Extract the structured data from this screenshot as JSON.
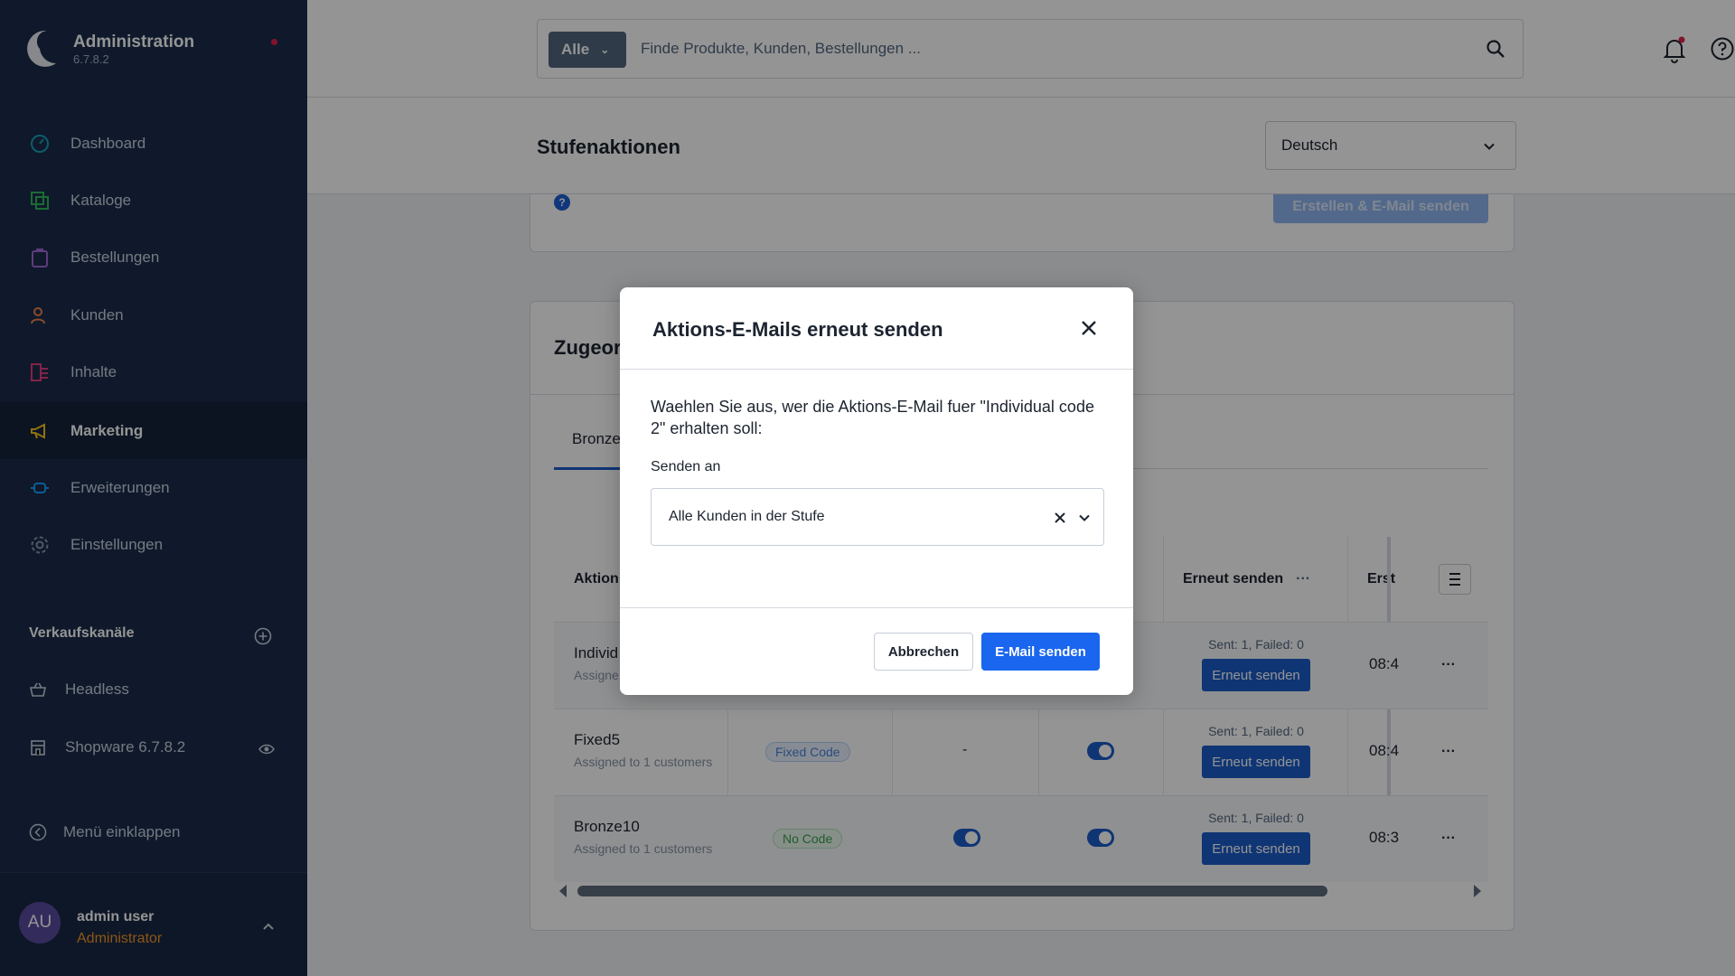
{
  "brand": {
    "title": "Administration",
    "version": "6.7.8.2"
  },
  "nav": [
    {
      "label": "Dashboard",
      "icon": "dashboard-icon"
    },
    {
      "label": "Kataloge",
      "icon": "catalog-icon"
    },
    {
      "label": "Bestellungen",
      "icon": "orders-icon"
    },
    {
      "label": "Kunden",
      "icon": "customers-icon"
    },
    {
      "label": "Inhalte",
      "icon": "content-icon"
    },
    {
      "label": "Marketing",
      "icon": "megaphone-icon",
      "active": true
    },
    {
      "label": "Erweiterungen",
      "icon": "plug-icon"
    },
    {
      "label": "Einstellungen",
      "icon": "gear-icon"
    }
  ],
  "sales_channels": {
    "heading": "Verkaufskanäle",
    "items": [
      {
        "label": "Headless",
        "icon": "basket-icon"
      },
      {
        "label": "Shopware 6.7.8.2",
        "icon": "storefront-icon"
      }
    ]
  },
  "collapse_label": "Menü einklappen",
  "user": {
    "initials": "AU",
    "name": "admin user",
    "role": "Administrator"
  },
  "search": {
    "type_label": "Alle",
    "placeholder": "Finde Produkte, Kunden, Bestellungen ..."
  },
  "page": {
    "title": "Stufenaktionen",
    "language": "Deutsch"
  },
  "card1": {
    "info": "?",
    "button": "Erstellen & E-Mail senden"
  },
  "card2": {
    "title": "Zugeordnete Aktionen",
    "tab": "Bronze",
    "columns": {
      "aktion": "Aktion",
      "erneut": "Erneut senden",
      "erstellt": "Erst",
      "more": "···"
    },
    "rows": [
      {
        "name": "Individ",
        "sub": "Assigne",
        "sent": "Sent: 1, Failed: 0",
        "resend": "Erneut senden",
        "time": "08:4"
      },
      {
        "name": "Fixed5",
        "sub": "Assigned to 1 customers",
        "badge": "Fixed Code",
        "dash": "-",
        "sent": "Sent: 1, Failed: 0",
        "resend": "Erneut senden",
        "time": "08:4"
      },
      {
        "name": "Bronze10",
        "sub": "Assigned to 1 customers",
        "badge": "No Code",
        "sent": "Sent: 1, Failed: 0",
        "resend": "Erneut senden",
        "time": "08:3"
      }
    ],
    "row_menu": "···"
  },
  "modal": {
    "title": "Aktions-E-Mails erneut senden",
    "description": "Waehlen Sie aus, wer die Aktions-E-Mail fuer \"Individual code 2\" erhalten soll:",
    "field_label": "Senden an",
    "field_value": "Alle Kunden in der Stufe",
    "cancel": "Abbrechen",
    "send": "E-Mail senden"
  },
  "colors": {
    "sidebar": "#1b2c4a",
    "primary": "#1a66ee",
    "accent_orange": "#f39527"
  }
}
